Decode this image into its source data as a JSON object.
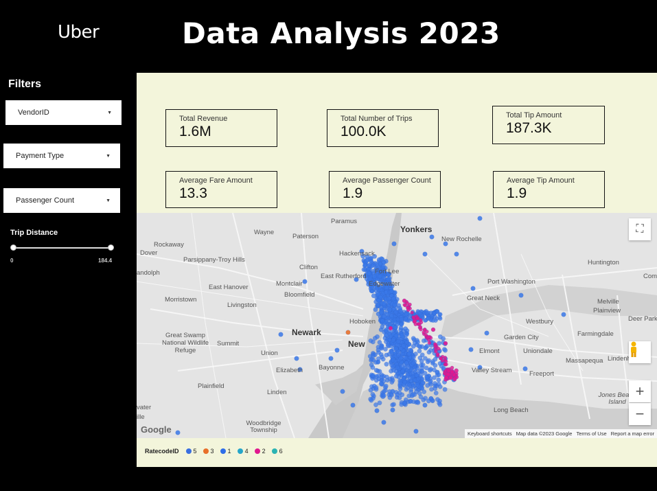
{
  "header": {
    "logo": "Uber",
    "title": "Data Analysis 2023"
  },
  "filters": {
    "title": "Filters",
    "dropdowns": [
      "VendorID",
      "Payment Type",
      "Passenger Count"
    ],
    "trip_distance": {
      "label": "Trip Distance",
      "min": "0",
      "max": "184.4",
      "range_low": 0,
      "range_high": 1
    }
  },
  "kpis": [
    {
      "label": "Total Revenue",
      "value": "1.6M"
    },
    {
      "label": "Total Number of Trips",
      "value": "100.0K"
    },
    {
      "label": "Total Tip Amount",
      "value": "187.3K"
    },
    {
      "label": "Average Fare Amount",
      "value": "13.3"
    },
    {
      "label": "Average Passenger Count",
      "value": "1.9"
    },
    {
      "label": "Average Tip Amount",
      "value": "1.9"
    }
  ],
  "map": {
    "places": [
      "Paramus",
      "Yonkers",
      "Wayne",
      "Paterson",
      "New Rochelle",
      "Rockaway",
      "Dover",
      "Parsippany-Troy Hills",
      "Hackensack",
      "andolph",
      "Clifton",
      "Huntington",
      "Fort Lee",
      "East Rutherford",
      "Edgewater",
      "Port Washington",
      "Com",
      "East Hanover",
      "Montclair",
      "Great Neck",
      "Melville",
      "Morristown",
      "Livingston",
      "Bloomfield",
      "Plainview",
      "Deer Park",
      "Westbury",
      "Newark",
      "Hoboken",
      "Farmingdale",
      "Great Swamp National Wildlife Refuge",
      "Summit",
      "Garden City",
      "Union",
      "Elmont",
      "Uniondale",
      "Elizabeth",
      "Bayonne",
      "Massapequa",
      "Lindenh",
      "Valley Stream",
      "Freeport",
      "Plainfield",
      "Linden",
      "Jones Beach Island",
      "vater",
      "ille",
      "Long Beach",
      "Woodbridge Township",
      "New"
    ],
    "google_logo": "Google",
    "attribution": [
      "Keyboard shortcuts",
      "Map data ©2023 Google",
      "Terms of Use",
      "Report a map error"
    ],
    "controls": {
      "fullscreen": "⛶",
      "pegman": "pegman",
      "zoom_in": "+",
      "zoom_out": "−"
    }
  },
  "legend": {
    "title": "RatecodeID",
    "items": [
      {
        "label": "5",
        "color": "#3a6fe0"
      },
      {
        "label": "3",
        "color": "#e8702a"
      },
      {
        "label": "1",
        "color": "#2f6ee8"
      },
      {
        "label": "4",
        "color": "#26a6c9"
      },
      {
        "label": "2",
        "color": "#e0188f"
      },
      {
        "label": "6",
        "color": "#2bb3b3"
      }
    ]
  },
  "colors": {
    "panel_bg": "#f3f5db",
    "trip_blue": "#3a78e8",
    "trip_pink": "#e0188f",
    "trip_orange": "#e8702a"
  }
}
